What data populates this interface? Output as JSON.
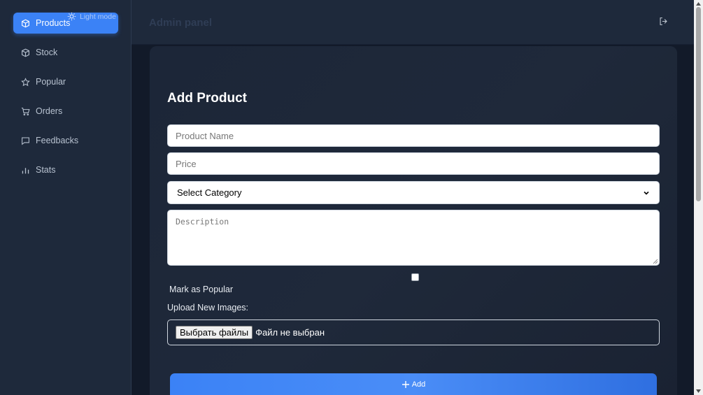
{
  "sidebar": {
    "theme_toggle_label": "Light mode",
    "items": [
      {
        "label": "Products",
        "icon": "box-icon",
        "active": true
      },
      {
        "label": "Stock",
        "icon": "cube-icon"
      },
      {
        "label": "Popular",
        "icon": "star-icon"
      },
      {
        "label": "Orders",
        "icon": "cart-icon"
      },
      {
        "label": "Feedbacks",
        "icon": "chat-icon"
      },
      {
        "label": "Stats",
        "icon": "bar-chart-icon"
      }
    ]
  },
  "header": {
    "title": "Admin panel",
    "logout_icon": "logout-icon"
  },
  "form": {
    "title": "Add Product",
    "product_name": {
      "value": "",
      "placeholder": "Product Name"
    },
    "price": {
      "value": "",
      "placeholder": "Price"
    },
    "category": {
      "selected": "Select Category"
    },
    "description": {
      "value": "",
      "placeholder": "Description"
    },
    "mark_popular_label": "Mark as Popular",
    "mark_popular_checked": false,
    "upload_label": "Upload New Images:",
    "file_button_label": "Выбрать файлы",
    "file_status": "Файл не выбран",
    "submit_label": "Add"
  },
  "colors": {
    "accent": "#3b82f6",
    "sidebar_bg": "#1e293b",
    "page_bg": "#121a29"
  }
}
